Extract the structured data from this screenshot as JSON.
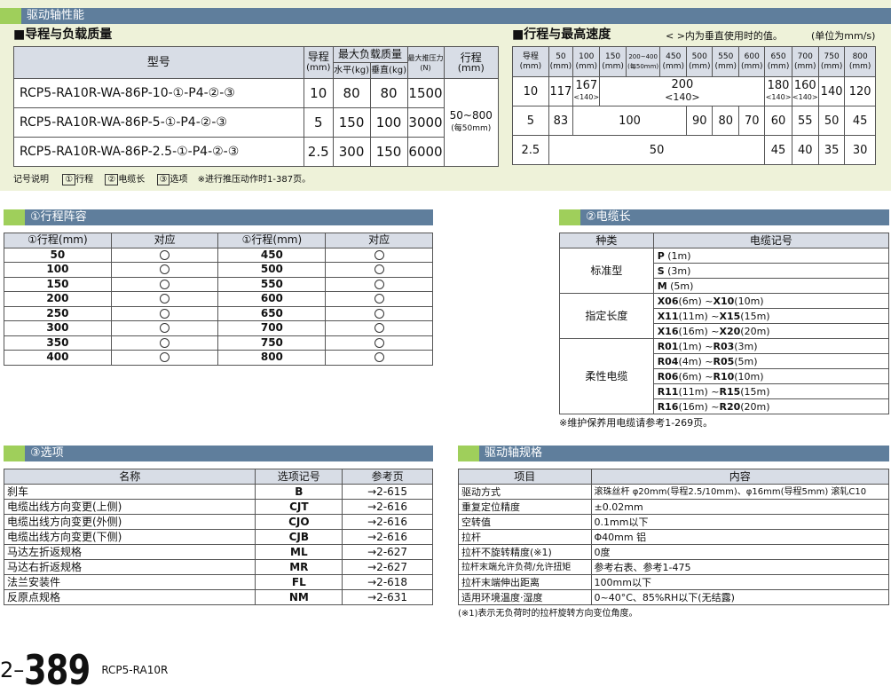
{
  "top_header": "驱动轴性能",
  "lead_load": {
    "title": "■导程与负载质量",
    "col_model": "型号",
    "col_lead": "导程",
    "col_lead_unit": "(mm)",
    "col_maxload": "最大负载质量",
    "col_horiz": "水平(kg)",
    "col_vert": "垂直(kg)",
    "col_thrust": "最大推压力",
    "col_thrust_unit": "(N)",
    "col_stroke": "行程",
    "col_stroke_unit": "(mm)",
    "rows": [
      {
        "model": "RCP5-RA10R-WA-86P-10-①-P4-②-③",
        "lead": "10",
        "horiz": "80",
        "vert": "80",
        "thrust": "1500"
      },
      {
        "model": "RCP5-RA10R-WA-86P-5-①-P4-②-③",
        "lead": "5",
        "horiz": "150",
        "vert": "100",
        "thrust": "3000"
      },
      {
        "model": "RCP5-RA10R-WA-86P-2.5-①-P4-②-③",
        "lead": "2.5",
        "horiz": "300",
        "vert": "150",
        "thrust": "6000"
      }
    ],
    "stroke_range": "50~800",
    "stroke_step": "(每50mm)"
  },
  "legend": {
    "label": "记号说明",
    "i1": "①",
    "t1": "行程",
    "i2": "②",
    "t2": "电缆长",
    "i3": "③",
    "t3": "选项",
    "ref": "※进行推压动作时1-387页。"
  },
  "speed": {
    "title": "■行程与最高速度",
    "note": "< >内为垂直使用时的值。",
    "unit": "(单位为mm/s)",
    "head_lead": "导程",
    "head_lead_unit": "(mm)",
    "strokes": [
      "50",
      "100",
      "150",
      "200~400",
      "450",
      "500",
      "550",
      "600",
      "650",
      "700",
      "750",
      "800"
    ],
    "stroke_units": [
      "(mm)",
      "(mm)",
      "(mm)",
      "(每50mm)",
      "(mm)",
      "(mm)",
      "(mm)",
      "(mm)",
      "(mm)",
      "(mm)",
      "(mm)",
      "(mm)"
    ],
    "r1": {
      "lead": "10",
      "c50": "117",
      "c100": "167",
      "c100v": "<140>",
      "c200": "200",
      "c200v": "<140>",
      "c650": "180",
      "c650v": "<140>",
      "c700": "160",
      "c700v": "<140>",
      "c750": "140",
      "c800": "120"
    },
    "r2": {
      "lead": "5",
      "c50": "83",
      "c100": "100",
      "c500": "90",
      "c550": "80",
      "c600": "70",
      "c650": "60",
      "c700": "55",
      "c750": "50",
      "c800": "45"
    },
    "r3": {
      "lead": "2.5",
      "c50": "50",
      "c650": "45",
      "c700": "40",
      "c750": "35",
      "c800": "30"
    }
  },
  "stroke_list": {
    "header": "①行程阵容",
    "col1": "①行程(mm)",
    "col2": "对应",
    "col3": "①行程(mm)",
    "col4": "对应",
    "left": [
      "50",
      "100",
      "150",
      "200",
      "250",
      "300",
      "350",
      "400"
    ],
    "right": [
      "450",
      "500",
      "550",
      "600",
      "650",
      "700",
      "750",
      "800"
    ]
  },
  "cable": {
    "header": "②电缆长",
    "col1": "种类",
    "col2": "电缆记号",
    "groups": [
      {
        "name": "标准型",
        "items": [
          [
            "P",
            "(1m)"
          ],
          [
            "S",
            "(3m)"
          ],
          [
            "M",
            "(5m)"
          ]
        ]
      },
      {
        "name": "指定长度",
        "items": [
          [
            "X06",
            "(6m) ~",
            "X10",
            "(10m)"
          ],
          [
            "X11",
            "(11m) ~",
            "X15",
            "(15m)"
          ],
          [
            "X16",
            "(16m) ~",
            "X20",
            "(20m)"
          ]
        ]
      },
      {
        "name": "柔性电缆",
        "items": [
          [
            "R01",
            "(1m) ~",
            "R03",
            "(3m)"
          ],
          [
            "R04",
            "(4m) ~",
            "R05",
            "(5m)"
          ],
          [
            "R06",
            "(6m) ~",
            "R10",
            "(10m)"
          ],
          [
            "R11",
            "(11m) ~",
            "R15",
            "(15m)"
          ],
          [
            "R16",
            "(16m) ~",
            "R20",
            "(20m)"
          ]
        ]
      }
    ],
    "note": "※维护保养用电缆请参考1-269页。"
  },
  "options": {
    "header": "③选项",
    "col1": "名称",
    "col2": "选项记号",
    "col3": "参考页",
    "rows": [
      [
        "刹车",
        "B",
        "→2-615"
      ],
      [
        "电缆出线方向变更(上侧)",
        "CJT",
        "→2-616"
      ],
      [
        "电缆出线方向变更(外侧)",
        "CJO",
        "→2-616"
      ],
      [
        "电缆出线方向变更(下侧)",
        "CJB",
        "→2-616"
      ],
      [
        "马达左折返规格",
        "ML",
        "→2-627"
      ],
      [
        "马达右折返规格",
        "MR",
        "→2-627"
      ],
      [
        "法兰安装件",
        "FL",
        "→2-618"
      ],
      [
        "反原点规格",
        "NM",
        "→2-631"
      ]
    ]
  },
  "spec": {
    "header": "驱动轴规格",
    "col1": "项目",
    "col2": "内容",
    "rows": [
      [
        "驱动方式",
        "滚珠丝杆  φ20mm(导程2.5/10mm)、φ16mm(导程5mm)  滚轧C10"
      ],
      [
        "重复定位精度",
        "±0.02mm"
      ],
      [
        "空转值",
        "0.1mm以下"
      ],
      [
        "拉杆",
        "Φ40mm    铝"
      ],
      [
        "拉杆不旋转精度(※1)",
        "0度"
      ],
      [
        "拉杆末端允许负荷/允许扭矩",
        "参考右表、参考1-475"
      ],
      [
        "拉杆末端伸出距离",
        "100mm以下"
      ],
      [
        "适用环境温度·湿度",
        "0~40°C、85%RH以下(无结露)"
      ]
    ],
    "note": "(※1)表示无负荷时的拉杆旋转方向变位角度。"
  },
  "footer": {
    "prefix": "2–",
    "page": "389",
    "model": "RCP5-RA10R"
  }
}
